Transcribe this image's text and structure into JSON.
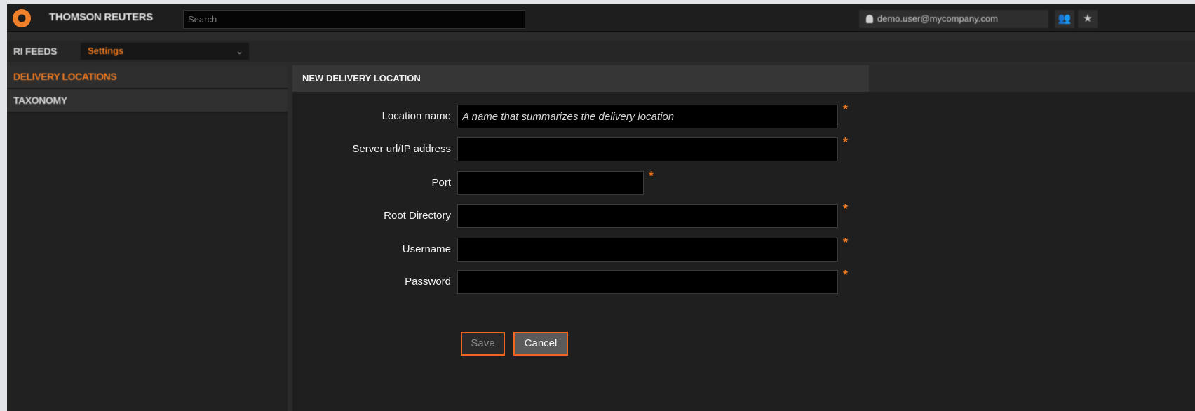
{
  "topbar": {
    "brand": "THOMSON REUTERS",
    "search_placeholder": "Search",
    "user": "demo.user@mycompany.com",
    "icons": [
      "users-icon",
      "star-icon"
    ]
  },
  "subbar": {
    "title": "RI FEEDS",
    "dropdown_value": "Settings"
  },
  "sidebar": {
    "items": [
      {
        "label": "DELIVERY LOCATIONS",
        "active": true
      },
      {
        "label": "TAXONOMY",
        "active": false
      }
    ]
  },
  "form": {
    "header": "NEW DELIVERY LOCATION",
    "fields": [
      {
        "label": "Location name",
        "placeholder": "A name that summarizes the delivery location",
        "value": "",
        "required": true
      },
      {
        "label": "Server url/IP address",
        "placeholder": "",
        "value": "",
        "required": true
      },
      {
        "label": "Port",
        "placeholder": "",
        "value": "",
        "required": true
      },
      {
        "label": "Root Directory",
        "placeholder": "",
        "value": "",
        "required": true
      },
      {
        "label": "Username",
        "placeholder": "",
        "value": "",
        "required": true
      },
      {
        "label": "Password",
        "placeholder": "",
        "value": "",
        "required": true
      }
    ],
    "required_marker": "*",
    "save_label": "Save",
    "cancel_label": "Cancel"
  },
  "colors": {
    "accent": "#f07a1f",
    "button_border": "#f0651f",
    "background": "#1f1f1f"
  }
}
